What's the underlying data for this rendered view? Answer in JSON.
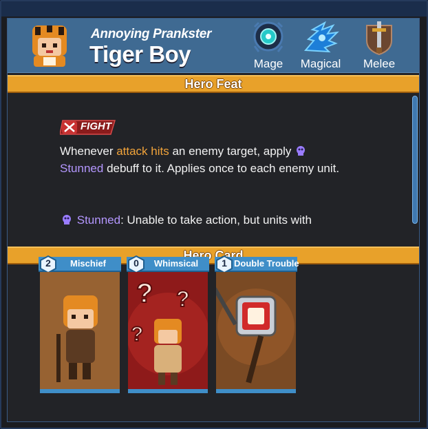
{
  "hero": {
    "subtitle": "Annoying Prankster",
    "name": "Tiger Boy"
  },
  "traits": [
    {
      "label": "Mage",
      "icon": "mage-gem-icon"
    },
    {
      "label": "Magical",
      "icon": "magical-wing-icon"
    },
    {
      "label": "Melee",
      "icon": "melee-sword-shield-icon"
    }
  ],
  "sections": {
    "feat_title": "Hero Feat",
    "card_title": "Hero Card"
  },
  "feat": {
    "badge": "FIGHT",
    "text_1": "Whenever ",
    "highlight_1": "attack hits",
    "text_2": " an enemy target, apply ",
    "highlight_2": "Stunned",
    "text_3": " debuff to it. Applies once to each enemy unit.",
    "status_name": "Stunned",
    "status_desc": ": Unable to take action, but units with"
  },
  "cards": [
    {
      "name": "Mischief",
      "cost": "2"
    },
    {
      "name": "Whimsical",
      "cost": "0"
    },
    {
      "name": "Double Trouble",
      "cost": "1"
    }
  ],
  "colors": {
    "header": "#3f6a92",
    "section_bar": "#e8a12a",
    "highlight_orange": "#f1a33a",
    "highlight_purple": "#b497ff",
    "card_title": "#3f8ec8"
  }
}
